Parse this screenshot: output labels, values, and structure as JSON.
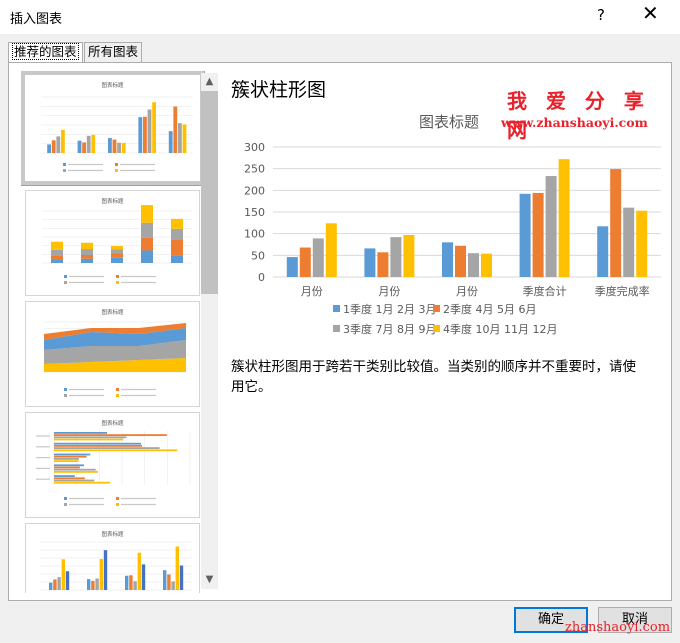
{
  "window": {
    "title": "插入图表",
    "help": "?",
    "close": "✕"
  },
  "tabs": [
    {
      "label": "推荐的图表"
    },
    {
      "label": "所有图表"
    }
  ],
  "thumbnails": {
    "title": "图表标题"
  },
  "preview": {
    "name": "簇状柱形图",
    "description": "簇状柱形图用于跨若干类别比较值。当类别的顺序并不重要时，请使用它。"
  },
  "watermark": {
    "cn": "我 爱 分 享 网",
    "url": "www.zhanshaoyi.com",
    "footer": "zhanshaoyi.com"
  },
  "buttons": {
    "ok": "确定",
    "cancel": "取消"
  },
  "colors": {
    "s1": "#5b9bd5",
    "s2": "#ed7d31",
    "s3": "#a5a5a5",
    "s4": "#ffc000",
    "accent": "#0078d7"
  },
  "chart_data": {
    "type": "bar",
    "title": "图表标题",
    "categories": [
      "月份",
      "月份",
      "月份",
      "季度合计",
      "季度完成率"
    ],
    "series": [
      {
        "name": "1季度 1月 2月 3月",
        "values": [
          46,
          66,
          80,
          192,
          117
        ]
      },
      {
        "name": "2季度 4月 5月 6月",
        "values": [
          68,
          57,
          72,
          194,
          249
        ]
      },
      {
        "name": "3季度 7月 8月 9月",
        "values": [
          89,
          92,
          55,
          233,
          160
        ]
      },
      {
        "name": "4季度 10月 11月 12月",
        "values": [
          124,
          97,
          54,
          272,
          153
        ]
      }
    ],
    "ylim": [
      0,
      300
    ],
    "yticks": [
      0,
      50,
      100,
      150,
      200,
      250,
      300
    ],
    "grid": true,
    "legend": "bottom"
  }
}
